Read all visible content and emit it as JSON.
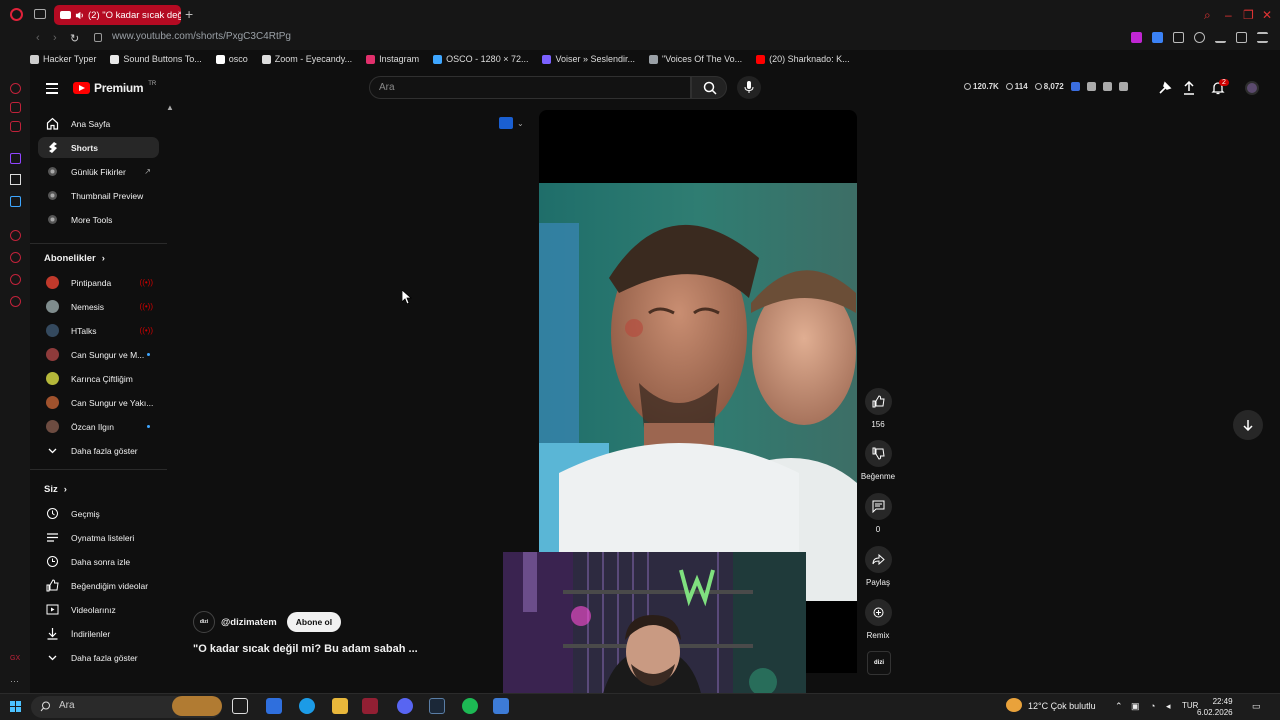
{
  "browser": {
    "tab_title": "(2) \"O kadar sıcak değ",
    "url": "www.youtube.com/shorts/PxgC3C4RtPg",
    "bookmarks": [
      {
        "label": "Hacker Typer",
        "icon": "chevron-icon",
        "color": "#cccccc"
      },
      {
        "label": "Sound Buttons To...",
        "icon": "sound-icon",
        "color": "#e8e8e8"
      },
      {
        "label": "osco",
        "icon": "dot-icon",
        "color": "#ffffff"
      },
      {
        "label": "Zoom - Eyecandy...",
        "icon": "zoom-icon",
        "color": "#dddddd"
      },
      {
        "label": "Instagram",
        "icon": "instagram-icon",
        "color": "#e1306c"
      },
      {
        "label": "OSCO - 1280 × 72...",
        "icon": "osco-icon",
        "color": "#3ea6ff"
      },
      {
        "label": "Voiser » Seslendir...",
        "icon": "voiser-icon",
        "color": "#7b61ff"
      },
      {
        "label": "\"Voices Of The Vo...",
        "icon": "voices-icon",
        "color": "#9aa0a6"
      },
      {
        "label": "(20) Sharknado: K...",
        "icon": "youtube-icon",
        "color": "#ff0000"
      }
    ]
  },
  "header": {
    "logo_text": "Premium",
    "region": "TR",
    "search_placeholder": "Ara",
    "stats": [
      {
        "icon": "clock-icon",
        "value": "120.7K"
      },
      {
        "icon": "eye-icon",
        "value": "114"
      },
      {
        "icon": "eye-icon",
        "value": "8,072"
      }
    ],
    "notification_count": "2"
  },
  "sidebar": {
    "main": [
      {
        "label": "Ana Sayfa",
        "icon": "home-icon",
        "active": false
      },
      {
        "label": "Shorts",
        "icon": "shorts-icon",
        "active": true
      },
      {
        "label": "Günlük Fikirler",
        "icon": "extension-icon",
        "active": false
      },
      {
        "label": "Thumbnail Preview",
        "icon": "extension-icon",
        "active": false
      },
      {
        "label": "More Tools",
        "icon": "extension-icon",
        "active": false
      }
    ],
    "subscriptions_heading": "Abonelikler",
    "subscriptions": [
      {
        "label": "Pintipanda",
        "color": "#c0392b",
        "status": "live"
      },
      {
        "label": "Nemesis",
        "color": "#7f8c8d",
        "status": "live"
      },
      {
        "label": "HTalks",
        "color": "#34495e",
        "status": "live"
      },
      {
        "label": "Can Sungur ve M...",
        "color": "#8e3b3b",
        "status": "new"
      },
      {
        "label": "Karınca Çiftliğim",
        "color": "#b5b83a",
        "status": ""
      },
      {
        "label": "Can Sungur ve Yakı...",
        "color": "#a0522d",
        "status": ""
      },
      {
        "label": "Özcan Ilgın",
        "color": "#6d4c41",
        "status": "new"
      }
    ],
    "subs_more": "Daha fazla göster",
    "you_heading": "Siz",
    "you": [
      {
        "label": "Geçmiş",
        "icon": "history-icon"
      },
      {
        "label": "Oynatma listeleri",
        "icon": "playlist-icon"
      },
      {
        "label": "Daha sonra izle",
        "icon": "clock-icon"
      },
      {
        "label": "Beğendiğim videolar",
        "icon": "like-icon"
      },
      {
        "label": "Videolarınız",
        "icon": "video-icon"
      },
      {
        "label": "İndirilenler",
        "icon": "download-icon"
      }
    ],
    "you_more": "Daha fazla göster"
  },
  "short": {
    "channel_handle": "@dizimatem",
    "channel_badge": "dizi",
    "subscribe_label": "Abone ol",
    "title": "\"O kadar sıcak değil mi? Bu adam sabah ...",
    "likes": "156",
    "dislike_label": "Beğenme",
    "comments": "0",
    "share_label": "Paylaş",
    "remix_label": "Remix"
  },
  "taskbar": {
    "search_placeholder": "Ara",
    "weather": "12°C  Çok bulutlu",
    "language": "TUR",
    "time": "22:49",
    "date": "6.02.2026"
  }
}
